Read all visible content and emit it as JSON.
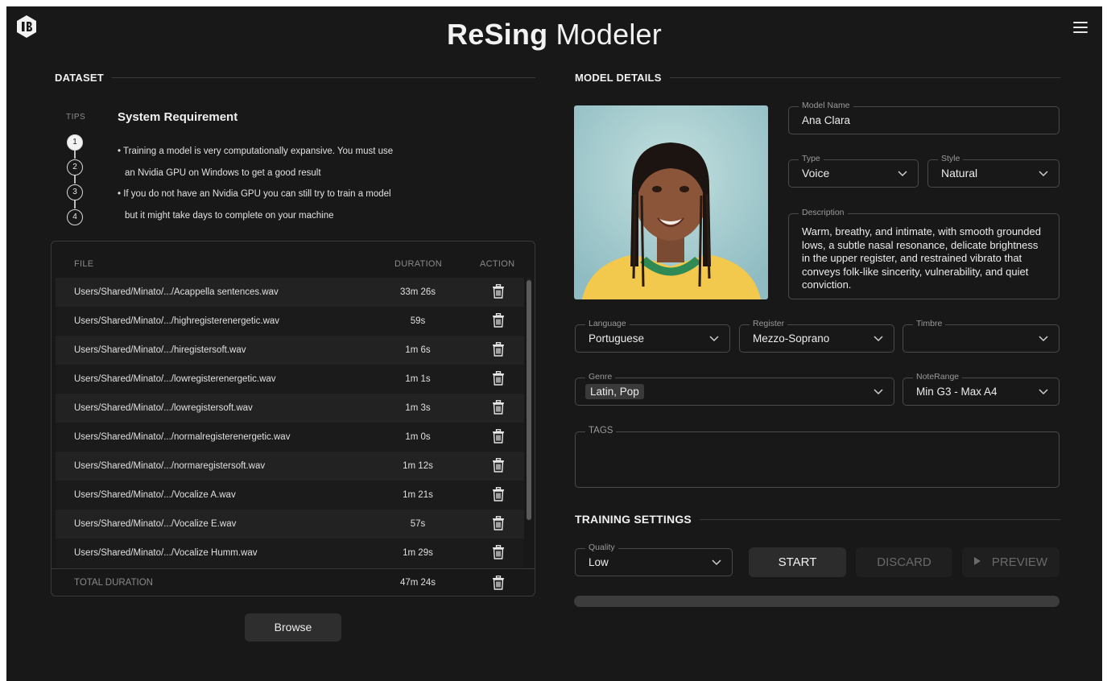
{
  "header": {
    "title_bold": "ReSing",
    "title_rest": " Modeler",
    "logo_icon": "resing-logo-icon",
    "menu_icon": "hamburger-menu-icon"
  },
  "dataset": {
    "section_title": "DATASET",
    "tips": {
      "label": "TIPS",
      "heading": "System Requirement",
      "steps": [
        "1",
        "2",
        "3",
        "4"
      ],
      "active_step": 1,
      "lines": [
        "• Training a model is very computationally expansive. You must use",
        "an Nvidia GPU on Windows to get a good result",
        "• If you do not have an Nvidia GPU you can still try to train a model",
        "but it might take days to complete on your machine"
      ]
    },
    "table": {
      "headers": {
        "file": "FILE",
        "duration": "DURATION",
        "action": "ACTION"
      },
      "rows": [
        {
          "file": "Users/Shared/Minato/.../Acappella sentences.wav",
          "duration": "33m 26s"
        },
        {
          "file": "Users/Shared/Minato/.../highregisterenergetic.wav",
          "duration": "59s"
        },
        {
          "file": "Users/Shared/Minato/.../hiregistersoft.wav",
          "duration": "1m 6s"
        },
        {
          "file": "Users/Shared/Minato/.../lowregisterenergetic.wav",
          "duration": "1m 1s"
        },
        {
          "file": "Users/Shared/Minato/.../lowregistersoft.wav",
          "duration": "1m 3s"
        },
        {
          "file": "Users/Shared/Minato/.../normalregisterenergetic.wav",
          "duration": "1m 0s"
        },
        {
          "file": "Users/Shared/Minato/.../normaregistersoft.wav",
          "duration": "1m 12s"
        },
        {
          "file": "Users/Shared/Minato/.../Vocalize A.wav",
          "duration": "1m 21s"
        },
        {
          "file": "Users/Shared/Minato/.../Vocalize E.wav",
          "duration": "57s"
        },
        {
          "file": "Users/Shared/Minato/.../Vocalize Humm.wav",
          "duration": "1m 29s"
        }
      ],
      "action_icon": "trash-icon",
      "total_label": "TOTAL DURATION",
      "total_value": "47m 24s"
    },
    "browse_label": "Browse"
  },
  "model": {
    "section_title": "MODEL DETAILS",
    "portrait_icon": "model-portrait-image",
    "name": {
      "label": "Model Name",
      "value": "Ana Clara"
    },
    "type": {
      "label": "Type",
      "value": "Voice"
    },
    "style": {
      "label": "Style",
      "value": "Natural"
    },
    "description": {
      "label": "Description",
      "value": "Warm, breathy, and intimate, with smooth grounded lows, a subtle nasal resonance, delicate brightness in the upper register, and restrained vibrato that conveys folk-like sincerity, vulnerability, and quiet conviction."
    },
    "language": {
      "label": "Language",
      "value": "Portuguese"
    },
    "register": {
      "label": "Register",
      "value": "Mezzo-Soprano"
    },
    "timbre": {
      "label": "Timbre",
      "value": ""
    },
    "genre": {
      "label": "Genre",
      "value": "Latin, Pop"
    },
    "note_range": {
      "label": "NoteRange",
      "value": "Min G3 - Max A4"
    },
    "tags": {
      "label": "TAGS",
      "value": ""
    }
  },
  "training": {
    "section_title": "TRAINING SETTINGS",
    "quality": {
      "label": "Quality",
      "value": "Low"
    },
    "start_label": "START",
    "discard_label": "DISCARD",
    "preview_label": "PREVIEW",
    "progress_fraction": 0
  },
  "colors": {
    "background": "#181818",
    "border": "#4a4a4a",
    "accent_yellow": "#f2c94c",
    "portrait_bg": "#a9cfd2"
  }
}
